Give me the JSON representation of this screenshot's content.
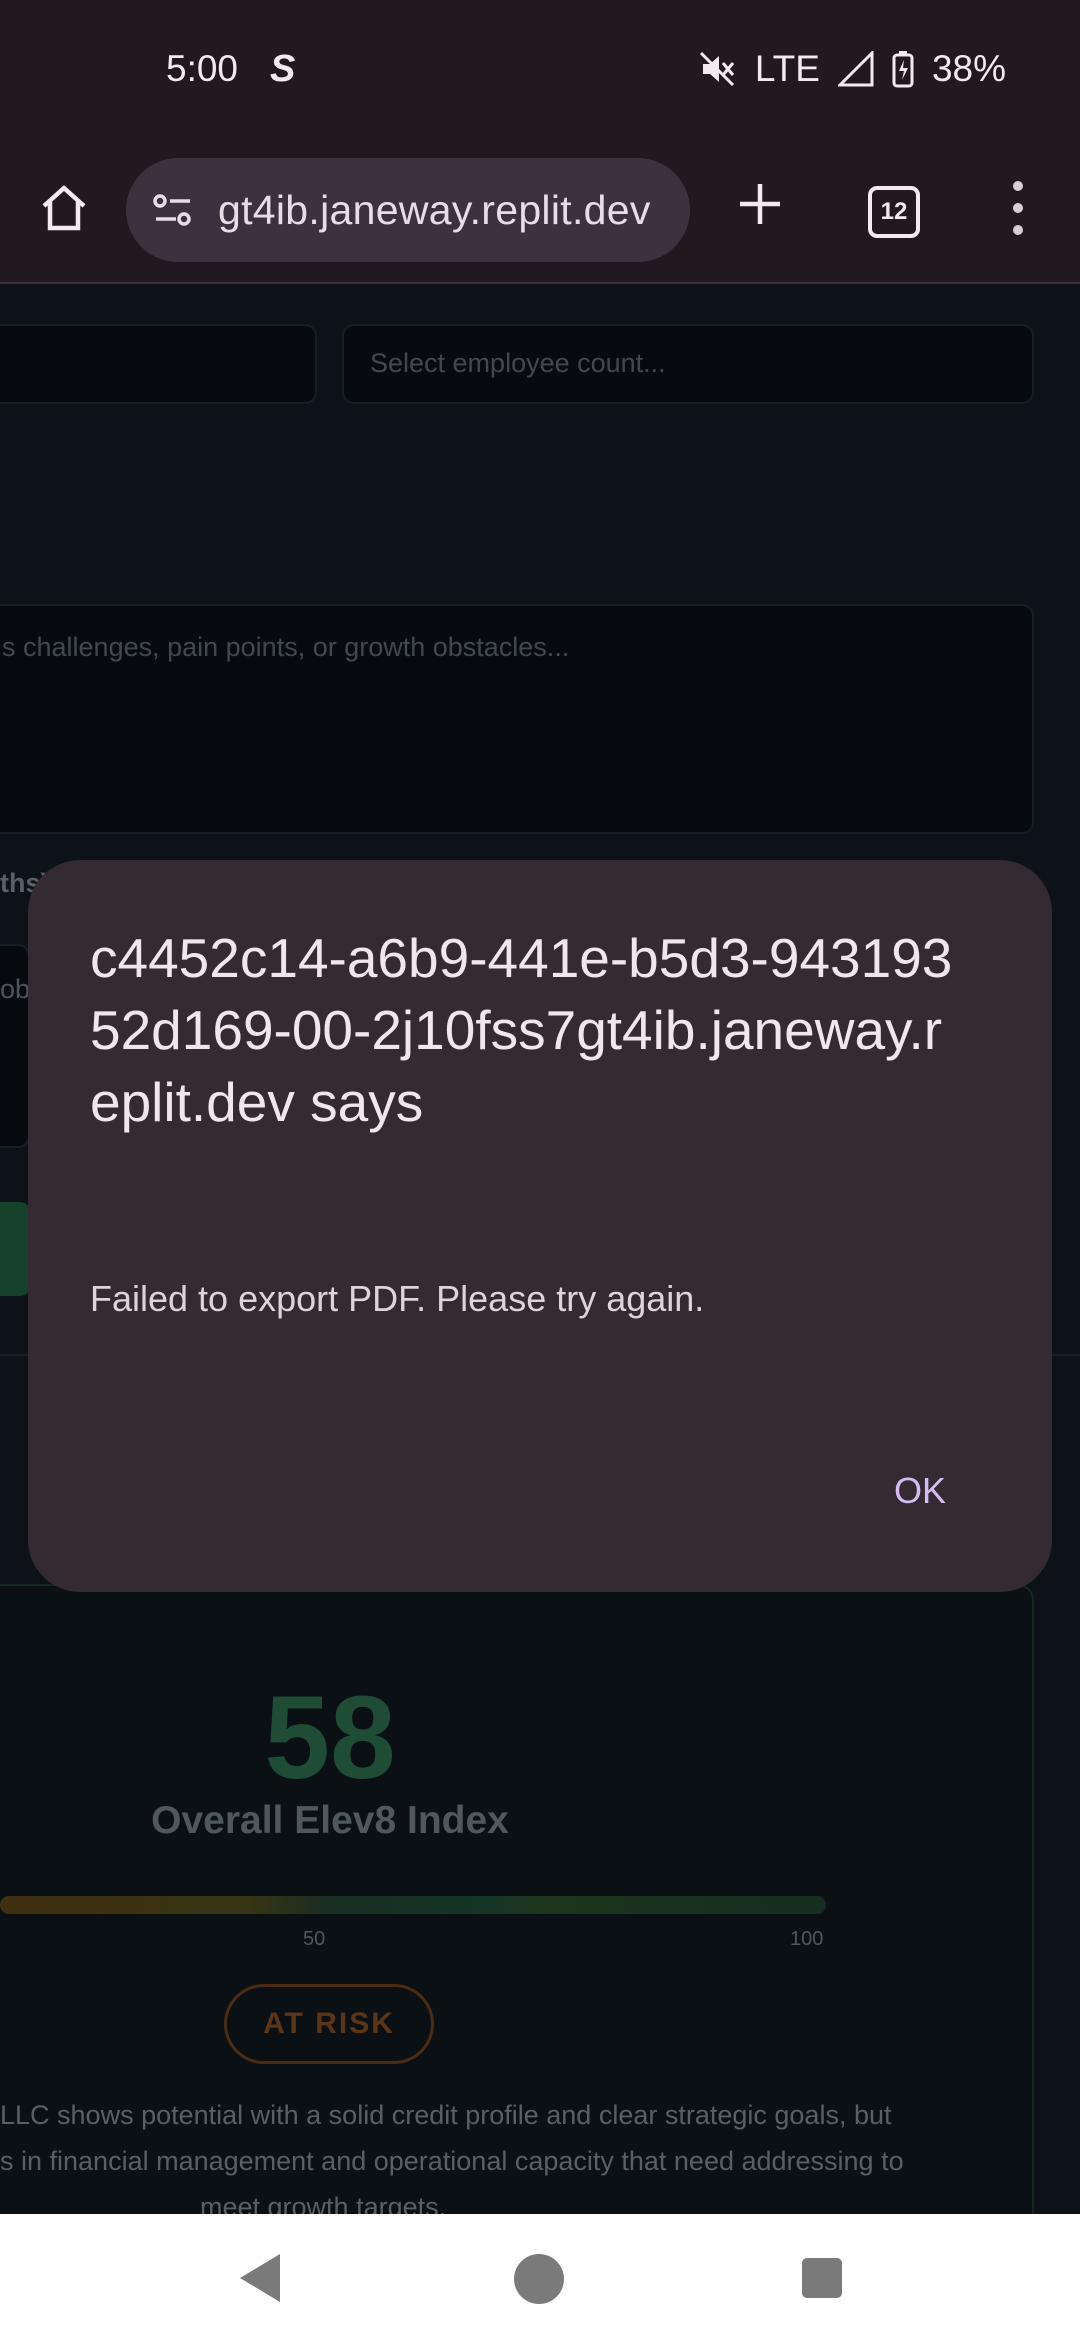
{
  "status_bar": {
    "time": "5:00",
    "app_icon": "S",
    "network": "LTE",
    "battery": "38%"
  },
  "toolbar": {
    "url": "gt4ib.janeway.replit.dev",
    "tab_count": "12"
  },
  "page": {
    "employee_count_placeholder": "Select employee count...",
    "challenges_placeholder": "s challenges, pain points, or growth obstacles...",
    "fragment_label": "ths)",
    "fragment_text": "ob",
    "score_value": "58",
    "score_label": "Overall Elev8 Index",
    "gauge_ticks": [
      "50",
      "100"
    ],
    "risk_badge": "AT RISK",
    "summary_lines": [
      "LLC shows potential with a solid credit profile and clear strategic goals, but",
      "s in financial management and operational capacity that need addressing to",
      "meet growth targets."
    ]
  },
  "dialog": {
    "title": "c4452c14-a6b9-441e-b5d3-94319352d169-00-2j10fss7gt4ib.janeway.replit.dev says",
    "message": "Failed to export PDF. Please try again.",
    "ok_label": "OK"
  }
}
